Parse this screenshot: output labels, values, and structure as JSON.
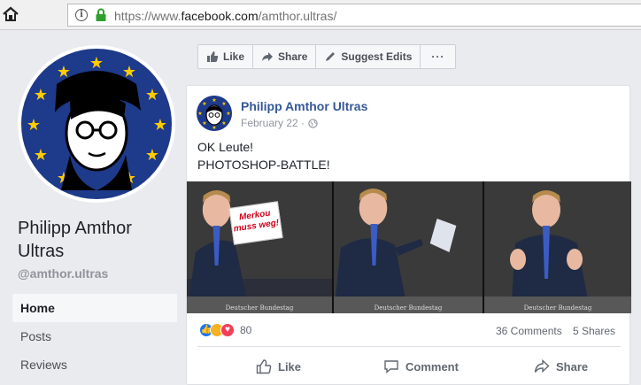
{
  "browser": {
    "url_prefix": "https://www.",
    "url_domain": "facebook.com",
    "url_path": "/amthor.ultras/"
  },
  "page": {
    "name": "Philipp Amthor Ultras",
    "handle": "@amthor.ultras",
    "nav": [
      {
        "label": "Home",
        "active": true
      },
      {
        "label": "Posts",
        "active": false
      },
      {
        "label": "Reviews",
        "active": false
      }
    ]
  },
  "actions": {
    "like": "Like",
    "share": "Share",
    "suggest": "Suggest Edits",
    "more": "···"
  },
  "post": {
    "author": "Philipp Amthor Ultras",
    "date": "February 22 ·",
    "line1": "OK Leute!",
    "line2": "PHOTOSHOP-BATTLE!",
    "sign_text": "Merkou muss weg!",
    "image_caption": "Deutscher Bundestag",
    "reaction_count": "80",
    "comments": "36 Comments",
    "shares": "5 Shares",
    "like_btn": "Like",
    "comment_btn": "Comment",
    "share_btn": "Share"
  },
  "colors": {
    "facebook_blue": "#365899",
    "eu_blue": "#1e3a8a",
    "eu_star": "#ffcc00"
  }
}
